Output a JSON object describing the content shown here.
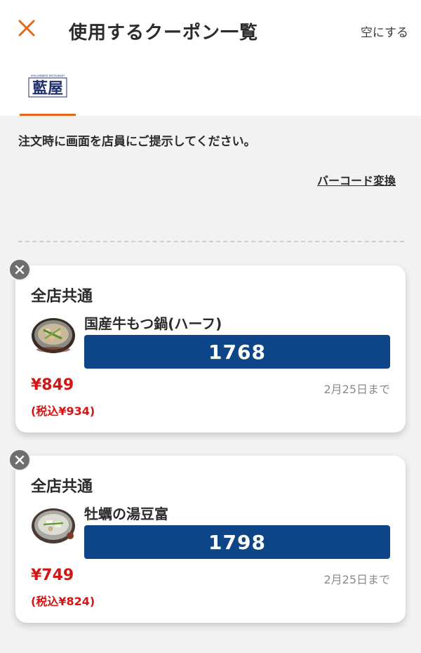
{
  "header": {
    "title": "使用するクーポン一覧",
    "clear_label": "空にする",
    "close_icon": "close-icon",
    "accent_color": "#e06a1c"
  },
  "store_tab": {
    "logo_text": "藍屋",
    "logo_caption": "AIYA JAPANESE RESTAURANT"
  },
  "instruction": "注文時に画面を店員にご提示してください。",
  "barcode_link": "バーコード変換",
  "coupons": [
    {
      "scope": "全店共通",
      "item": "国産牛もつ鍋(ハーフ)",
      "code": "1768",
      "price": "¥849",
      "price_tax": "(税込¥934)",
      "expiry": "2月25日まで"
    },
    {
      "scope": "全店共通",
      "item": "牡蠣の湯豆富",
      "code": "1798",
      "price": "¥749",
      "price_tax": "(税込¥824)",
      "expiry": "2月25日まで"
    }
  ],
  "colors": {
    "code_bg": "#0e4588",
    "price": "#d51414",
    "background": "#f2f2f2"
  }
}
